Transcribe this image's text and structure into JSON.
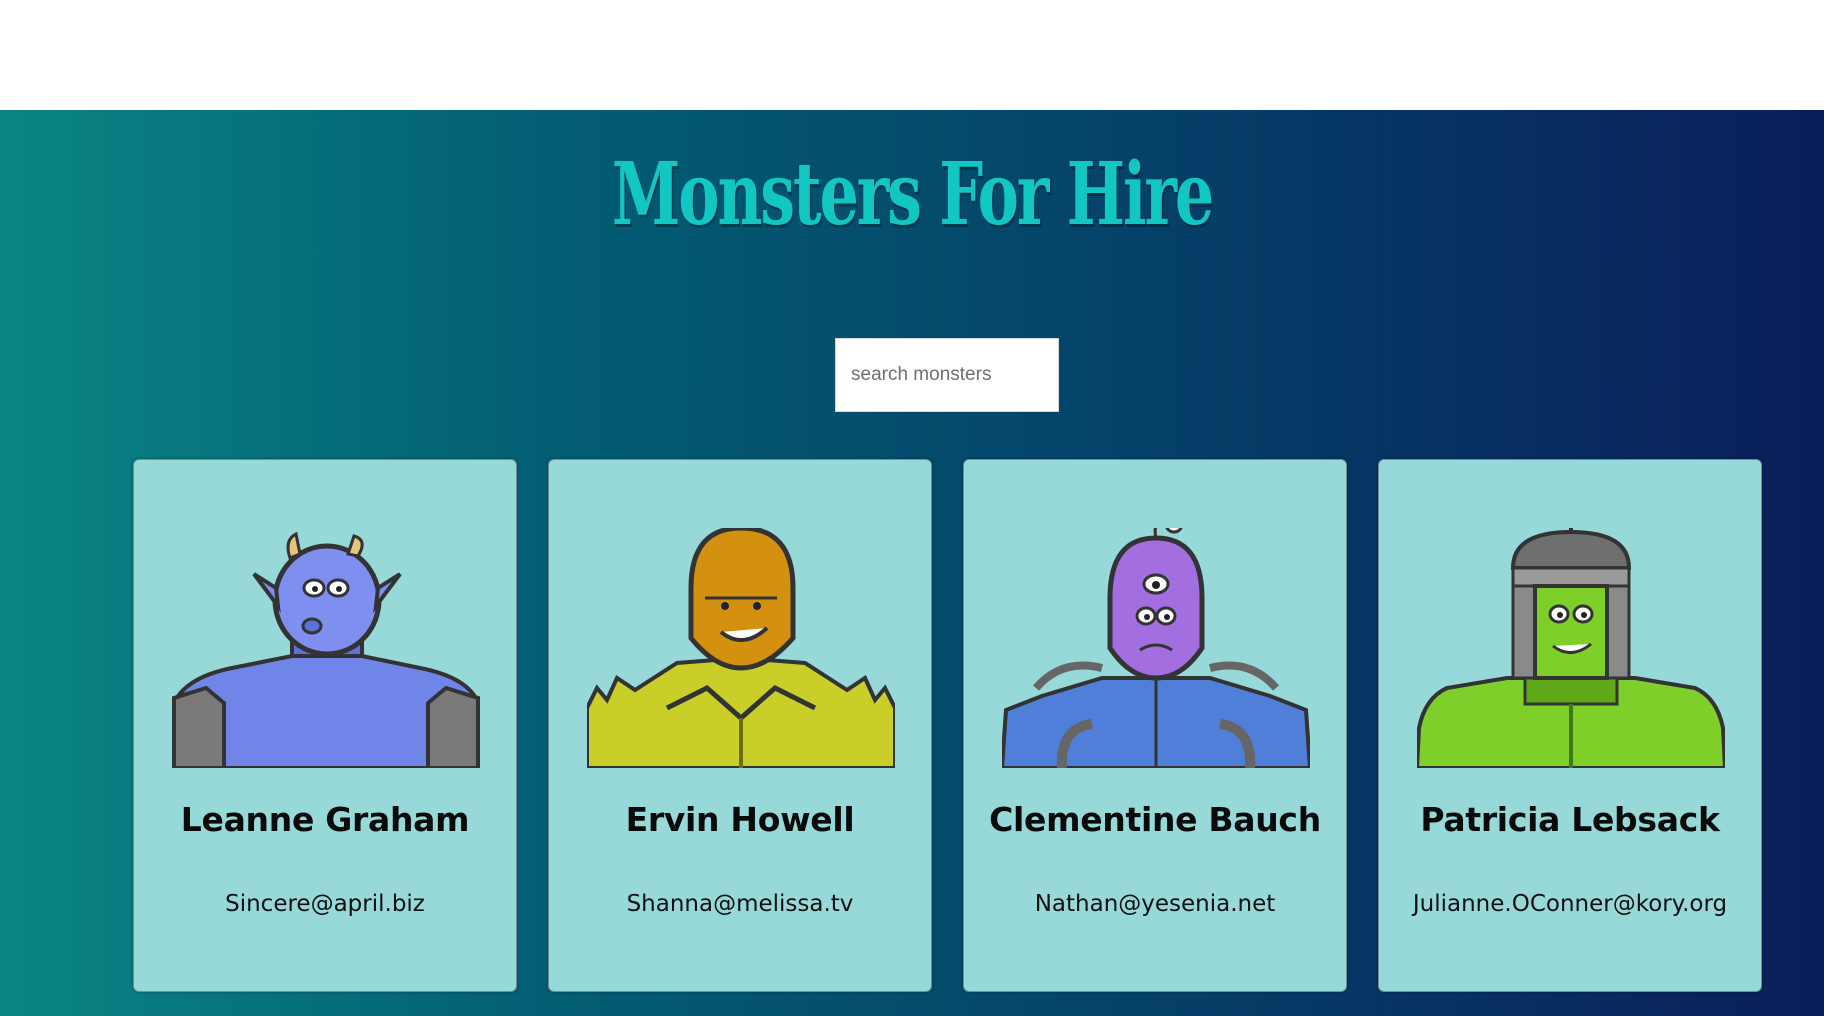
{
  "header": {
    "title": "Monsters For Hire"
  },
  "search": {
    "placeholder": "search monsters"
  },
  "monsters": [
    {
      "name": "Leanne Graham",
      "email": "Sincere@april.biz",
      "color": "#6f86e8",
      "icon": "blue-horned-monster-avatar"
    },
    {
      "name": "Ervin Howell",
      "email": "Shanna@melissa.tv",
      "color": "#d4900f",
      "icon": "orange-spiky-monster-avatar"
    },
    {
      "name": "Clementine Bauch",
      "email": "Nathan@yesenia.net",
      "color": "#a26ee0",
      "icon": "purple-cyclops-robot-avatar"
    },
    {
      "name": "Patricia Lebsack",
      "email": "Julianne.OConner@kory.org",
      "color": "#7fcf2a",
      "icon": "green-helmet-monster-avatar"
    }
  ]
}
